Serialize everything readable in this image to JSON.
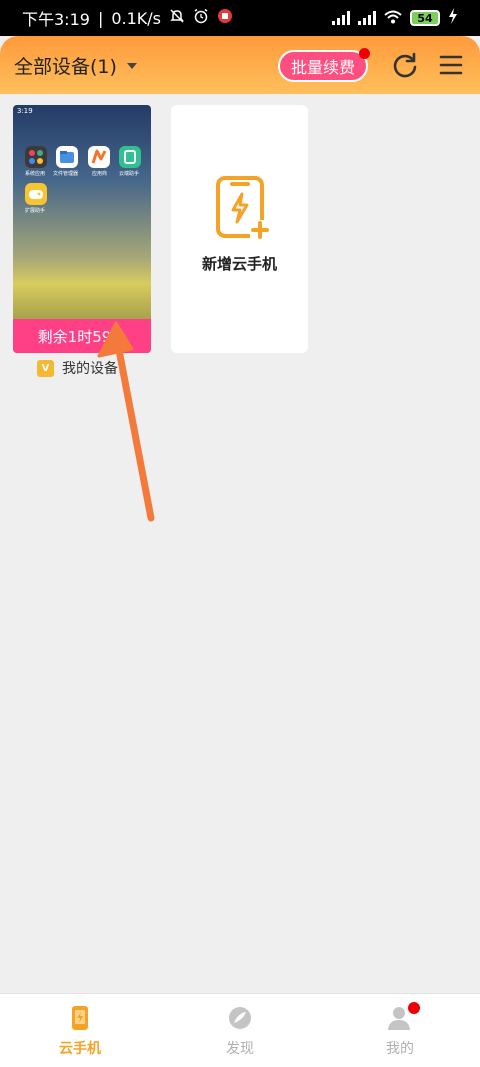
{
  "status_bar": {
    "time": "下午3:19",
    "speed": "0.1K/s",
    "battery": "54"
  },
  "header": {
    "title": "全部设备(1)",
    "renew_button": "批量续费"
  },
  "devices": [
    {
      "screen_time": "3:19",
      "remaining": "剩余1时59分",
      "name": "我的设备1",
      "apps": [
        "系统应用",
        "文件管理器",
        "应用商",
        "云端助手",
        "扩展助手"
      ]
    }
  ],
  "add_card": {
    "label": "新增云手机"
  },
  "bottom_nav": [
    {
      "label": "云手机",
      "active": true
    },
    {
      "label": "发现",
      "active": false
    },
    {
      "label": "我的",
      "active": false
    }
  ],
  "colors": {
    "accent": "#f5a327",
    "header_start": "#ff9a3c",
    "header_end": "#ffbf5b",
    "pink": "#ff3f86",
    "arrow": "#f47a3c"
  }
}
